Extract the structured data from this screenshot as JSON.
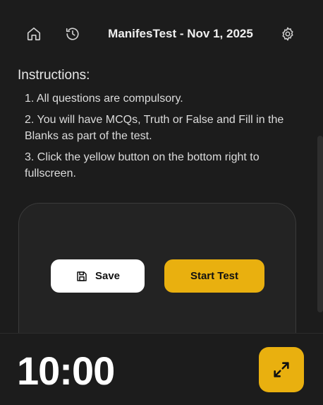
{
  "header": {
    "title": "ManifesTest - Nov 1, 2025",
    "home_icon": "home-icon",
    "history_icon": "history-icon",
    "settings_icon": "gear-icon"
  },
  "instructions": {
    "title": "Instructions:",
    "items": [
      "1. All questions are compulsory.",
      "2. You will have MCQs, Truth or False and Fill in the Blanks as part of the test.",
      "3. Click the yellow button on the bottom right to fullscreen."
    ]
  },
  "actions": {
    "save_label": "Save",
    "save_icon": "save-icon",
    "start_label": "Start Test"
  },
  "footer": {
    "timer": "10:00",
    "fullscreen_icon": "expand-icon"
  },
  "colors": {
    "background": "#1c1c1c",
    "accent": "#e9b00f",
    "text": "#e6e6e6"
  }
}
